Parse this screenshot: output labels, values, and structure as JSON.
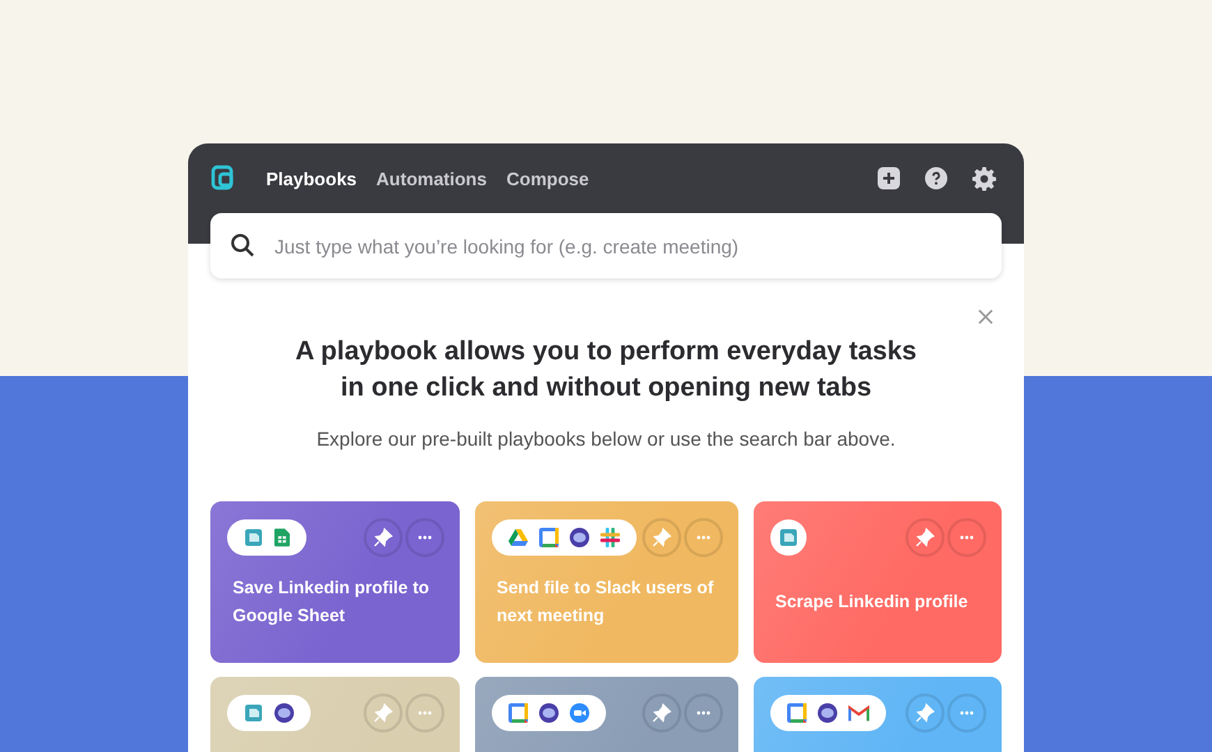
{
  "nav": {
    "tabs": [
      {
        "label": "Playbooks",
        "selected": true
      },
      {
        "label": "Automations",
        "selected": false
      },
      {
        "label": "Compose",
        "selected": false
      }
    ]
  },
  "search": {
    "placeholder": "Just type what you’re looking for (e.g. create meeting)"
  },
  "intro": {
    "title": "A playbook allows you to perform everyday tasks in one click and without opening new tabs",
    "subtitle": "Explore our pre-built playbooks below or use the search bar above."
  },
  "cards": [
    {
      "title": "Save Linkedin profile to Google Sheet",
      "color": "#7a64d0",
      "apps": [
        {
          "kind": "scraper"
        },
        {
          "kind": "sheets"
        }
      ]
    },
    {
      "title": "Send file to Slack users of next meeting",
      "color": "#f0b860",
      "apps": [
        {
          "kind": "drive"
        },
        {
          "kind": "calendar"
        },
        {
          "kind": "brain"
        },
        {
          "kind": "slack"
        }
      ]
    },
    {
      "title": "Scrape Linkedin profile",
      "color": "#ff6a64",
      "apps": [
        {
          "kind": "scraper"
        }
      ]
    },
    {
      "color": "#d9ceae",
      "apps": [
        {
          "kind": "scraper"
        },
        {
          "kind": "brain"
        }
      ]
    },
    {
      "color": "#8a9db5",
      "apps": [
        {
          "kind": "calendar"
        },
        {
          "kind": "brain"
        },
        {
          "kind": "zoom"
        }
      ]
    },
    {
      "color": "#5fb5f5",
      "apps": [
        {
          "kind": "calendar"
        },
        {
          "kind": "brain"
        },
        {
          "kind": "gmail"
        }
      ]
    }
  ]
}
